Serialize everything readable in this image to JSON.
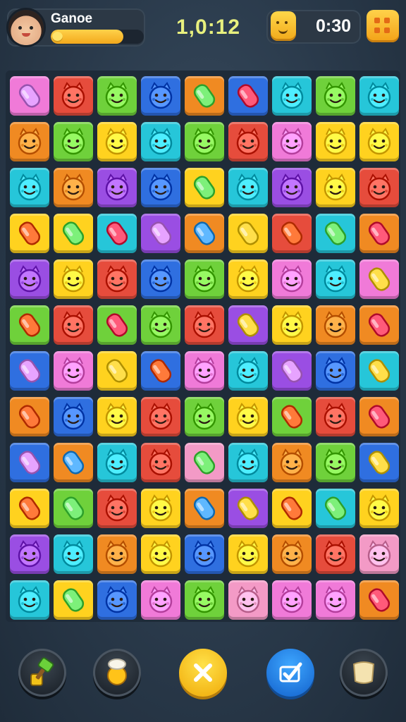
{
  "header": {
    "player_name": "Ganoe",
    "score": "1,0:12",
    "timer": "0:30",
    "xp_progress": 0.78
  },
  "colors": {
    "pink": "#f07ad8",
    "red": "#e64c3c",
    "green": "#6fd13b",
    "blue": "#2f6fe0",
    "orange": "#f08a22",
    "cyan": "#26c6d9",
    "yellow": "#ffd21f",
    "purple": "#9a4ee3",
    "lightgreen": "#9ee34a",
    "rose": "#f39ac6"
  },
  "board": {
    "rows": 12,
    "cols": 9,
    "tiles": [
      [
        "pink",
        "red",
        "green",
        "blue",
        "orange",
        "blue",
        "cyan",
        "green",
        "cyan"
      ],
      [
        "orange",
        "green",
        "yellow",
        "cyan",
        "green",
        "red",
        "pink",
        "yellow",
        "yellow"
      ],
      [
        "cyan",
        "orange",
        "purple",
        "blue",
        "yellow",
        "cyan",
        "purple",
        "yellow",
        "red"
      ],
      [
        "yellow",
        "yellow",
        "cyan",
        "purple",
        "orange",
        "yellow",
        "red",
        "cyan",
        "orange"
      ],
      [
        "purple",
        "yellow",
        "red",
        "blue",
        "green",
        "yellow",
        "pink",
        "cyan",
        "pink"
      ],
      [
        "green",
        "red",
        "green",
        "green",
        "red",
        "purple",
        "yellow",
        "orange",
        "orange"
      ],
      [
        "blue",
        "pink",
        "yellow",
        "blue",
        "pink",
        "cyan",
        "purple",
        "blue",
        "cyan"
      ],
      [
        "orange",
        "blue",
        "yellow",
        "red",
        "green",
        "yellow",
        "green",
        "red",
        "orange"
      ],
      [
        "blue",
        "orange",
        "cyan",
        "red",
        "rose",
        "cyan",
        "orange",
        "green",
        "blue"
      ],
      [
        "yellow",
        "green",
        "red",
        "yellow",
        "orange",
        "purple",
        "yellow",
        "cyan",
        "yellow"
      ],
      [
        "purple",
        "cyan",
        "orange",
        "yellow",
        "blue",
        "yellow",
        "orange",
        "red",
        "rose"
      ],
      [
        "cyan",
        "yellow",
        "blue",
        "pink",
        "green",
        "rose",
        "pink",
        "pink",
        "orange"
      ]
    ],
    "icons": [
      [
        "gem",
        "face",
        "face",
        "face",
        "gem",
        "gem",
        "face",
        "face",
        "face"
      ],
      [
        "face",
        "face",
        "face",
        "face",
        "face",
        "face",
        "face",
        "face",
        "face"
      ],
      [
        "face",
        "face",
        "face",
        "face",
        "gem",
        "face",
        "face",
        "face",
        "face"
      ],
      [
        "gem",
        "gem",
        "gem",
        "gem",
        "gem",
        "gem",
        "gem",
        "gem",
        "gem"
      ],
      [
        "face",
        "face",
        "face",
        "face",
        "face",
        "face",
        "face",
        "face",
        "gem"
      ],
      [
        "gem",
        "face",
        "gem",
        "face",
        "face",
        "gem",
        "face",
        "face",
        "gem"
      ],
      [
        "gem",
        "face",
        "gem",
        "gem",
        "face",
        "face",
        "gem",
        "face",
        "gem"
      ],
      [
        "gem",
        "face",
        "face",
        "face",
        "face",
        "face",
        "gem",
        "face",
        "gem"
      ],
      [
        "gem",
        "gem",
        "face",
        "face",
        "gem",
        "face",
        "face",
        "face",
        "gem"
      ],
      [
        "gem",
        "gem",
        "face",
        "face",
        "gem",
        "gem",
        "gem",
        "gem",
        "face"
      ],
      [
        "face",
        "face",
        "face",
        "face",
        "face",
        "face",
        "face",
        "face",
        "face"
      ],
      [
        "face",
        "gem",
        "face",
        "face",
        "face",
        "face",
        "face",
        "face",
        "gem"
      ]
    ]
  },
  "powerups": [
    {
      "name": "hammer",
      "icon": "hammer-icon",
      "style": "dark"
    },
    {
      "name": "chef",
      "icon": "chef-icon",
      "style": "dark"
    },
    {
      "name": "cancel",
      "icon": "close-icon",
      "style": "yellow"
    },
    {
      "name": "check",
      "icon": "check-icon",
      "style": "blue"
    },
    {
      "name": "tile",
      "icon": "scroll-icon",
      "style": "dark"
    }
  ]
}
